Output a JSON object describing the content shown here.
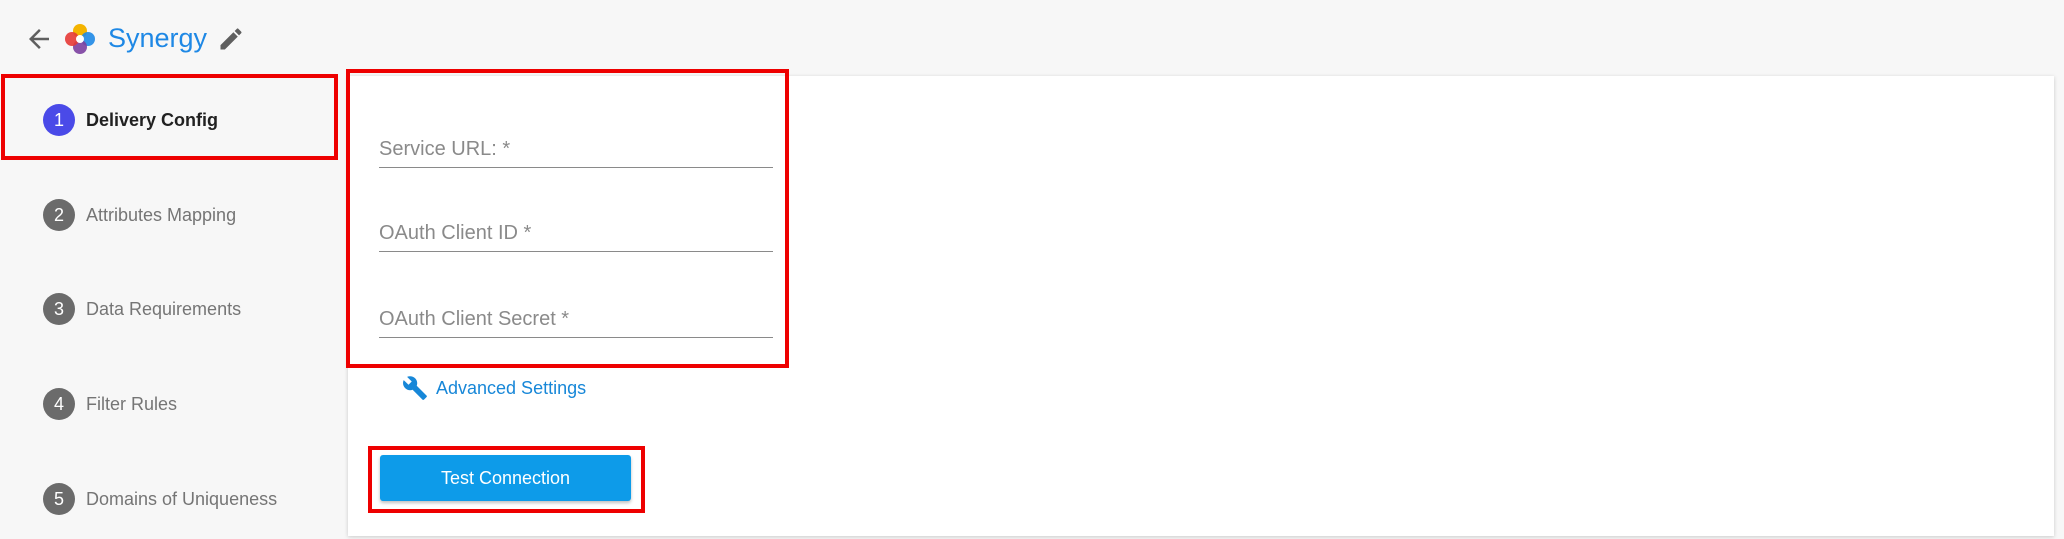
{
  "header": {
    "title": "Synergy",
    "back_icon": "arrow-left",
    "logo_icon": "synergy-logo",
    "edit_icon": "pencil"
  },
  "steps": [
    {
      "number": "1",
      "label": "Delivery Config",
      "active": true
    },
    {
      "number": "2",
      "label": "Attributes Mapping",
      "active": false
    },
    {
      "number": "3",
      "label": "Data Requirements",
      "active": false
    },
    {
      "number": "4",
      "label": "Filter Rules",
      "active": false
    },
    {
      "number": "5",
      "label": "Domains of Uniqueness",
      "active": false
    }
  ],
  "form": {
    "fields": [
      {
        "placeholder": "Service URL: *",
        "value": ""
      },
      {
        "placeholder": "OAuth Client ID *",
        "value": ""
      },
      {
        "placeholder": "OAuth Client Secret *",
        "value": ""
      }
    ],
    "advanced_settings_label": "Advanced Settings",
    "test_button_label": "Test Connection"
  },
  "colors": {
    "accent": "#1e88e5",
    "active_step": "#4a4ae8",
    "inactive_step": "#6b6b6b",
    "button": "#0d9be9",
    "highlight": "#ee0000"
  }
}
